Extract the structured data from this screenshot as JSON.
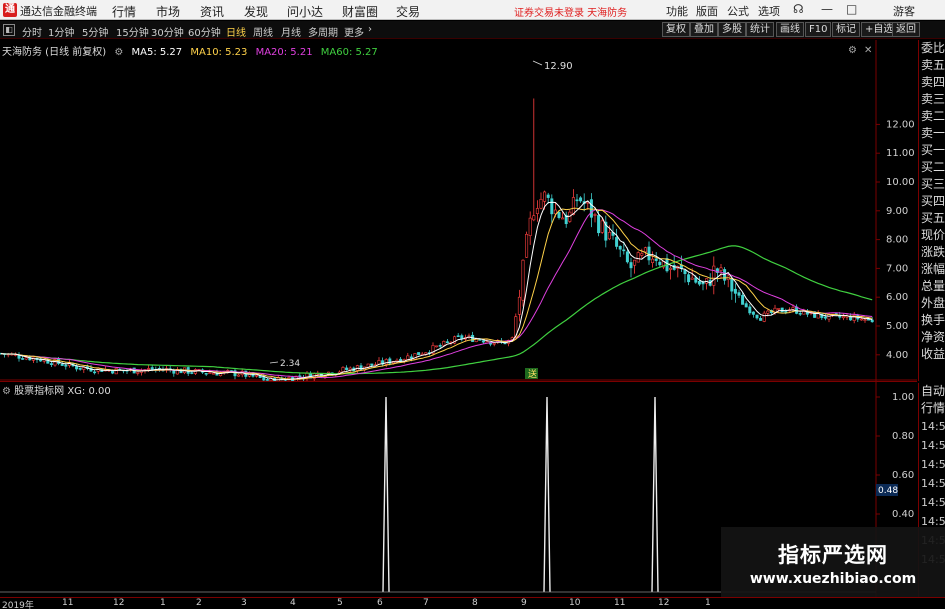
{
  "titlebar": {
    "logo": "通",
    "app_title": "通达信金融终端",
    "menus": [
      "行情",
      "市场",
      "资讯",
      "发现",
      "问小达",
      "财富圈",
      "交易"
    ],
    "warning": "证券交易未登录  天海防务",
    "right_menus": [
      "功能",
      "版面",
      "公式",
      "选项"
    ],
    "guest": "游客"
  },
  "toolbar": {
    "periods": [
      "分时",
      "1分钟",
      "5分钟",
      "15分钟",
      "30分钟",
      "60分钟",
      "日线",
      "周线",
      "月线",
      "多周期",
      "更多"
    ],
    "active_period": "日线",
    "right_buttons": [
      "复权",
      "叠加",
      "多股",
      "统计",
      "画线",
      "F10",
      "标记",
      "+自选",
      "返回"
    ]
  },
  "main_chart": {
    "stock_label": "天海防务 (日线 前复权)",
    "ma": [
      {
        "label": "MA5: 5.27",
        "color": "#ffffff"
      },
      {
        "label": "MA10: 5.23",
        "color": "#ffd24a"
      },
      {
        "label": "MA20: 5.21",
        "color": "#e040e0"
      },
      {
        "label": "MA60: 5.27",
        "color": "#40d040"
      }
    ],
    "high_label": "12.90",
    "low_label": "2.34",
    "event_marker": "送",
    "y_ticks": [
      "12.00",
      "11.00",
      "10.00",
      "9.00",
      "8.00",
      "7.00",
      "6.00",
      "5.00",
      "4.00"
    ]
  },
  "indicator": {
    "label": "股票指标网  XG: 0.00",
    "y_ticks": [
      "1.00",
      "0.80",
      "0.60",
      "0.48",
      "0.40"
    ],
    "current_value": "0.48"
  },
  "sidebar_main": [
    "委比",
    "卖五",
    "卖四",
    "卖三",
    "卖二",
    "卖一",
    "买一",
    "买二",
    "买三",
    "买四",
    "买五",
    "现价",
    "涨跌",
    "涨幅",
    "总量",
    "外盘",
    "换手",
    "净资",
    "收益"
  ],
  "sidebar_bottom": {
    "labels": [
      "自动",
      "行情"
    ],
    "times": [
      "14:5",
      "14:5",
      "14:5",
      "14:5",
      "14:5",
      "14:5",
      "14:5",
      "14:5"
    ]
  },
  "time_axis": [
    "2019年",
    "11",
    "12",
    "1",
    "2",
    "3",
    "4",
    "5",
    "6",
    "7",
    "8",
    "9",
    "10",
    "11",
    "12",
    "1"
  ],
  "watermark": {
    "title": "指标严选网",
    "url": "www.xuezhibiao.com"
  },
  "colors": {
    "up": "#ff4040",
    "down": "#40d0d0",
    "grid": "#7a0000",
    "ma5": "#ffffff",
    "ma10": "#ffd24a",
    "ma20": "#e040e0",
    "ma60": "#40d040"
  }
}
